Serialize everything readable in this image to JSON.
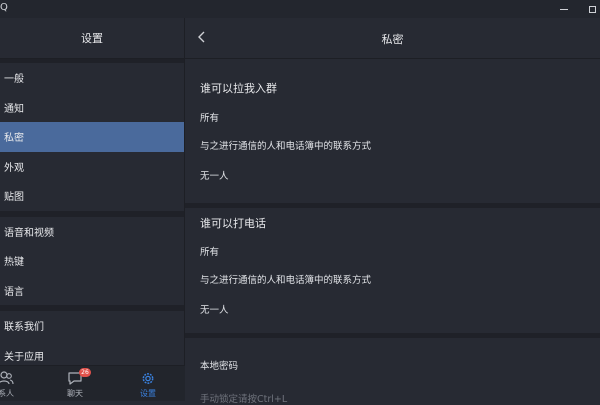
{
  "window": {
    "app_glyph": "Q",
    "minimize_icon": "minimize-icon",
    "maximize_icon": "maximize-icon"
  },
  "sidebar": {
    "title": "设置",
    "items": [
      {
        "label": "一般",
        "active": false
      },
      {
        "label": "通知",
        "active": false
      },
      {
        "label": "私密",
        "active": true
      },
      {
        "label": "外观",
        "active": false
      },
      {
        "label": "贴图",
        "active": false
      },
      {
        "label": "语音和视频",
        "active": false
      },
      {
        "label": "热键",
        "active": false
      },
      {
        "label": "语言",
        "active": false
      },
      {
        "label": "联系我们",
        "active": false
      },
      {
        "label": "关于应用",
        "active": false
      }
    ]
  },
  "bottom_nav": {
    "contacts": {
      "label": "系人",
      "icon": "contacts-icon"
    },
    "chat": {
      "label": "聊天",
      "icon": "chat-icon",
      "badge": "26"
    },
    "settings": {
      "label": "设置",
      "icon": "settings-gear-icon",
      "active_color": "#3a82e0"
    }
  },
  "main": {
    "title": "私密",
    "group_invite": {
      "title": "谁可以拉我入群",
      "options": [
        "所有",
        "与之进行通信的人和电话簿中的联系方式",
        "无一人"
      ]
    },
    "calls": {
      "title": "谁可以打电话",
      "options": [
        "所有",
        "与之进行通信的人和电话簿中的联系方式",
        "无一人"
      ]
    },
    "local_password": {
      "label": "本地密码",
      "hint": "手动锁定请按Ctrl+L"
    }
  },
  "colors": {
    "accent": "#4a6a9c",
    "badge": "#e0514b",
    "background": "#272a33"
  }
}
